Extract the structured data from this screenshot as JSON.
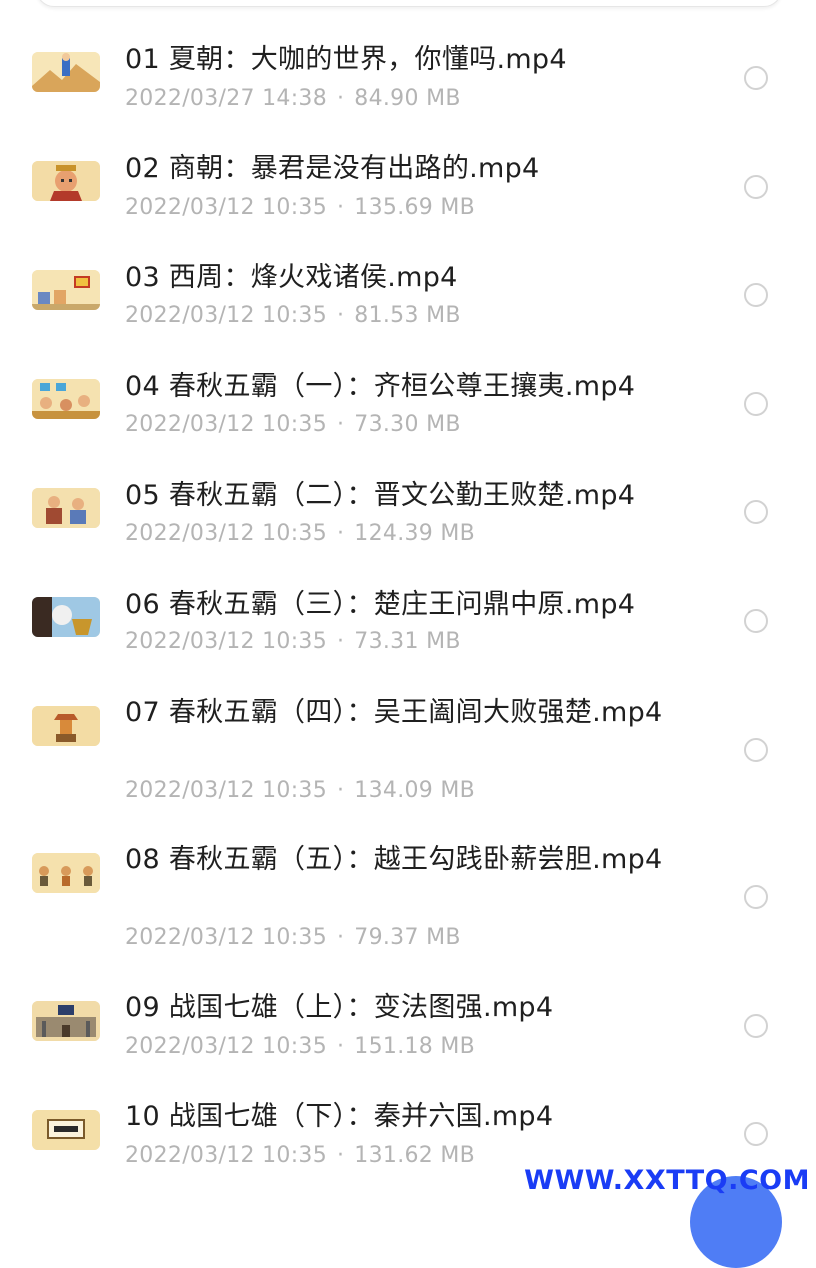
{
  "files": [
    {
      "title": "01 夏朝：大咖的世界，你懂吗.mp4",
      "date": "2022/03/27 14:38",
      "size": "84.90 MB",
      "thumb_icon": "mountain-sage-thumbnail"
    },
    {
      "title": "02 商朝：暴君是没有出路的.mp4",
      "date": "2022/03/12 10:35",
      "size": "135.69 MB",
      "thumb_icon": "angry-king-thumbnail"
    },
    {
      "title": "03 西周：烽火戏诸侯.mp4",
      "date": "2022/03/12 10:35",
      "size": "81.53 MB",
      "thumb_icon": "beacon-tower-thumbnail"
    },
    {
      "title": "04 春秋五霸（一）：齐桓公尊王攘夷.mp4",
      "date": "2022/03/12 10:35",
      "size": "73.30 MB",
      "thumb_icon": "kings-gathering-thumbnail"
    },
    {
      "title": "05 春秋五霸（二）：晋文公勤王败楚.mp4",
      "date": "2022/03/12 10:35",
      "size": "124.39 MB",
      "thumb_icon": "warriors-thumbnail"
    },
    {
      "title": "06 春秋五霸（三）：楚庄王问鼎中原.mp4",
      "date": "2022/03/12 10:35",
      "size": "73.31 MB",
      "thumb_icon": "bronze-cauldron-thumbnail"
    },
    {
      "title": "07 春秋五霸（四）：吴王阖闾大败强楚.mp4",
      "date": "2022/03/12 10:35",
      "size": "134.09 MB",
      "thumb_icon": "pagoda-thumbnail"
    },
    {
      "title": "08 春秋五霸（五）：越王勾践卧薪尝胆.mp4",
      "date": "2022/03/12 10:35",
      "size": "79.37 MB",
      "thumb_icon": "figures-row-thumbnail"
    },
    {
      "title": "09 战国七雄（上）：变法图强.mp4",
      "date": "2022/03/12 10:35",
      "size": "151.18 MB",
      "thumb_icon": "city-gate-thumbnail"
    },
    {
      "title": "10 战国七雄（下）：秦并六国.mp4",
      "date": "2022/03/12 10:35",
      "size": "131.62 MB",
      "thumb_icon": "sign-board-thumbnail"
    }
  ],
  "separator": "·",
  "watermark": "WWW.XXTTQ.COM",
  "colors": {
    "title": "#1f1f1f",
    "meta": "#b4b4b4",
    "radio": "#d2d2d2",
    "watermark": "#1a3cf5",
    "fab": "#4f7df5"
  }
}
